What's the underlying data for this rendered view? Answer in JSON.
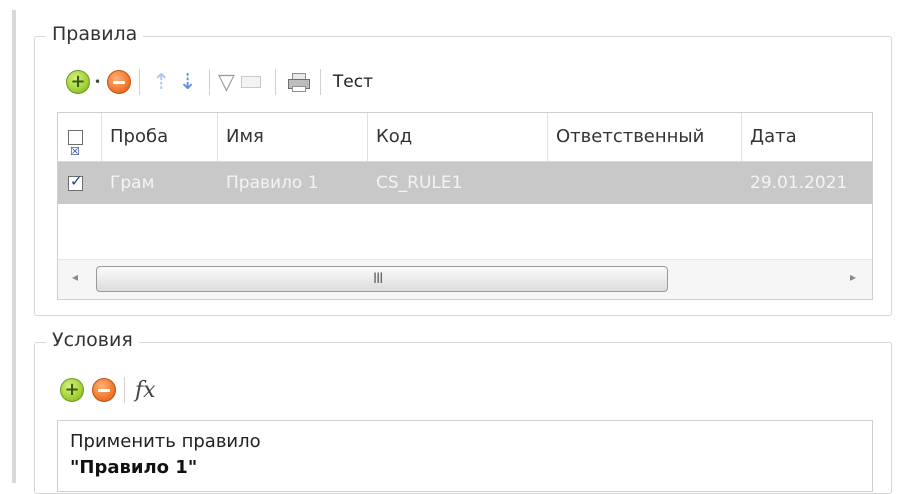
{
  "rules_group": {
    "title": "Правила",
    "toolbar": {
      "dropdown_marker": "•",
      "test_label": "Тест"
    },
    "columns": [
      "Проба",
      "Имя",
      "Код",
      "Ответственный",
      "Дата"
    ],
    "rows": [
      {
        "checked": true,
        "sample": "Грам",
        "name": "Правило 1",
        "code": "CS_RULE1",
        "responsible": "",
        "date": "29.01.2021"
      }
    ],
    "scroll_grip": "III"
  },
  "conditions_group": {
    "title": "Условия",
    "toolbar": {
      "fx_label": "fx"
    },
    "text_line1": "Применить правило",
    "text_line2": "\"Правило 1\""
  },
  "colors": {
    "selected_row": "#c8c8c8",
    "add_button": "#a6d43a",
    "remove_button": "#f0782d",
    "arrow": "#5b8fd6"
  }
}
